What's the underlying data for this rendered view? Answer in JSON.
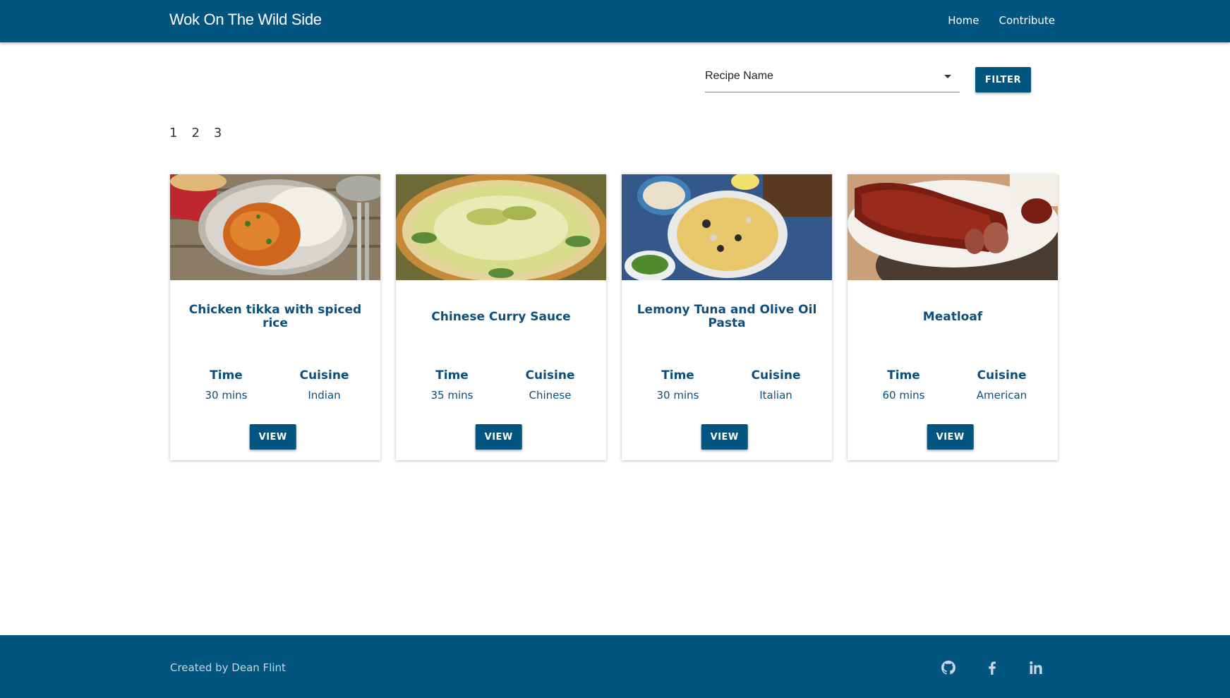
{
  "navbar": {
    "brand": "Wok On The Wild Side",
    "links": [
      {
        "label": "Home"
      },
      {
        "label": "Contribute"
      }
    ]
  },
  "filter": {
    "selected": "Recipe Name",
    "button_label": "FILTER"
  },
  "pagination": {
    "pages": [
      "1",
      "2",
      "3"
    ]
  },
  "cards": [
    {
      "title": "Chicken tikka with spiced rice",
      "time_label": "Time",
      "time": "30 mins",
      "cuisine_label": "Cuisine",
      "cuisine": "Indian",
      "button": "VIEW"
    },
    {
      "title": "Chinese Curry Sauce",
      "time_label": "Time",
      "time": "35 mins",
      "cuisine_label": "Cuisine",
      "cuisine": "Chinese",
      "button": "VIEW"
    },
    {
      "title": "Lemony Tuna and Olive Oil Pasta",
      "time_label": "Time",
      "time": "30 mins",
      "cuisine_label": "Cuisine",
      "cuisine": "Italian",
      "button": "VIEW"
    },
    {
      "title": "Meatloaf",
      "time_label": "Time",
      "time": "60 mins",
      "cuisine_label": "Cuisine",
      "cuisine": "American",
      "button": "VIEW"
    }
  ],
  "footer": {
    "credit": "Created by Dean Flint",
    "social_icons": [
      "github-icon",
      "facebook-icon",
      "linkedin-icon"
    ]
  },
  "colors": {
    "primary": "#01557f",
    "text": "#0d4f7a",
    "footer_text": "#c7d6e2"
  }
}
